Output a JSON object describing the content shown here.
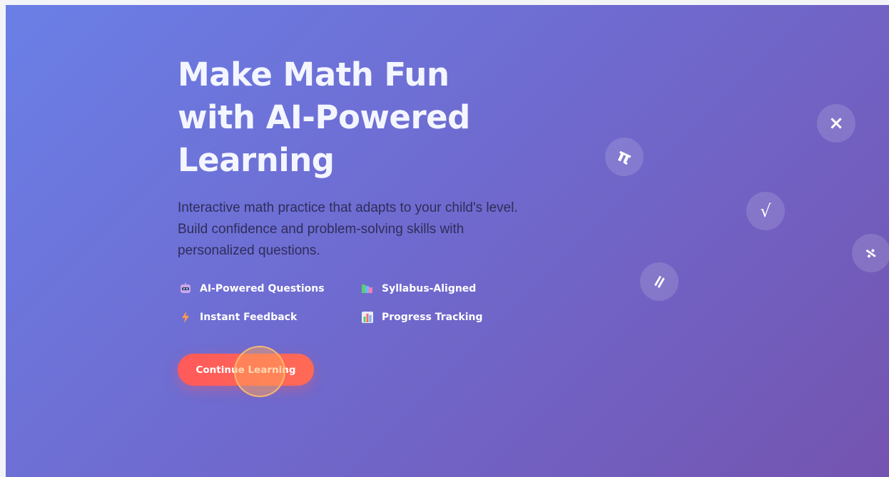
{
  "hero": {
    "headline_lines": [
      "Make Math Fun",
      "with AI-Powered",
      "Learning"
    ],
    "subtitle": "Interactive math practice that adapts to your child's level. Build confidence and problem-solving skills with personalized questions.",
    "features": [
      {
        "label": "AI-Powered Questions",
        "icon": "robot-icon"
      },
      {
        "label": "Syllabus-Aligned",
        "icon": "books-icon"
      },
      {
        "label": "Instant Feedback",
        "icon": "lightning-icon"
      },
      {
        "label": "Progress Tracking",
        "icon": "chart-icon"
      }
    ],
    "cta_label": "Continue Learning"
  },
  "floating_symbols": [
    {
      "symbol": "π",
      "icon": "pi-symbol"
    },
    {
      "symbol": "×",
      "icon": "multiply-symbol"
    },
    {
      "symbol": "√",
      "icon": "sqrt-symbol"
    },
    {
      "symbol": "÷",
      "icon": "divide-symbol"
    },
    {
      "symbol": "=",
      "icon": "equals-symbol"
    }
  ],
  "colors": {
    "gradient_start": "#6a7fe6",
    "gradient_end": "#7454b0",
    "cta": "#ff5a5a",
    "headline": "#f4f6ff"
  }
}
